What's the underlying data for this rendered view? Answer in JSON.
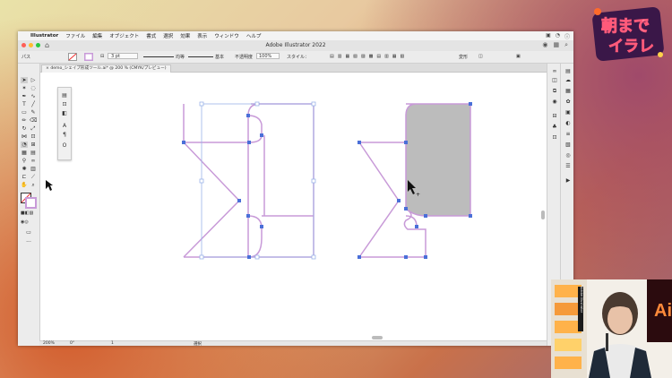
{
  "menubar": {
    "apple": "",
    "app": "Illustrator",
    "items": [
      "ファイル",
      "編集",
      "オブジェクト",
      "書式",
      "選択",
      "効果",
      "表示",
      "ウィンドウ",
      "ヘルプ"
    ],
    "right_icons": [
      "control-center-icon",
      "wifi-icon",
      "info-icon"
    ]
  },
  "window": {
    "title": "Adobe Illustrator 2022",
    "tab_label": "demo_シェイプ形成ツール.ai* @ 200 % (CMYK/プレビュー)"
  },
  "control_bar": {
    "object_type": "パス",
    "stroke_weight": "3 pt",
    "profile_label": "均等",
    "brush_label": "基本",
    "opacity_label": "不透明度",
    "opacity_value": "100%",
    "style_label": "スタイル：",
    "transform_label": "変形"
  },
  "status_bar": {
    "zoom": "200%",
    "angle": "0°",
    "artboard": "1",
    "tool_name": "選択"
  },
  "overlay": {
    "logo_line1": "朝まで",
    "logo_line2": "イラレ"
  },
  "webcam": {
    "poster_text": "Ai",
    "book_label": "Adobe Illustrator"
  },
  "colors": {
    "path_stroke": "#c89ad8",
    "anchor": "#4a6fd8",
    "fill_shape": "#bcbcbc",
    "selection": "#9cb4e8"
  }
}
